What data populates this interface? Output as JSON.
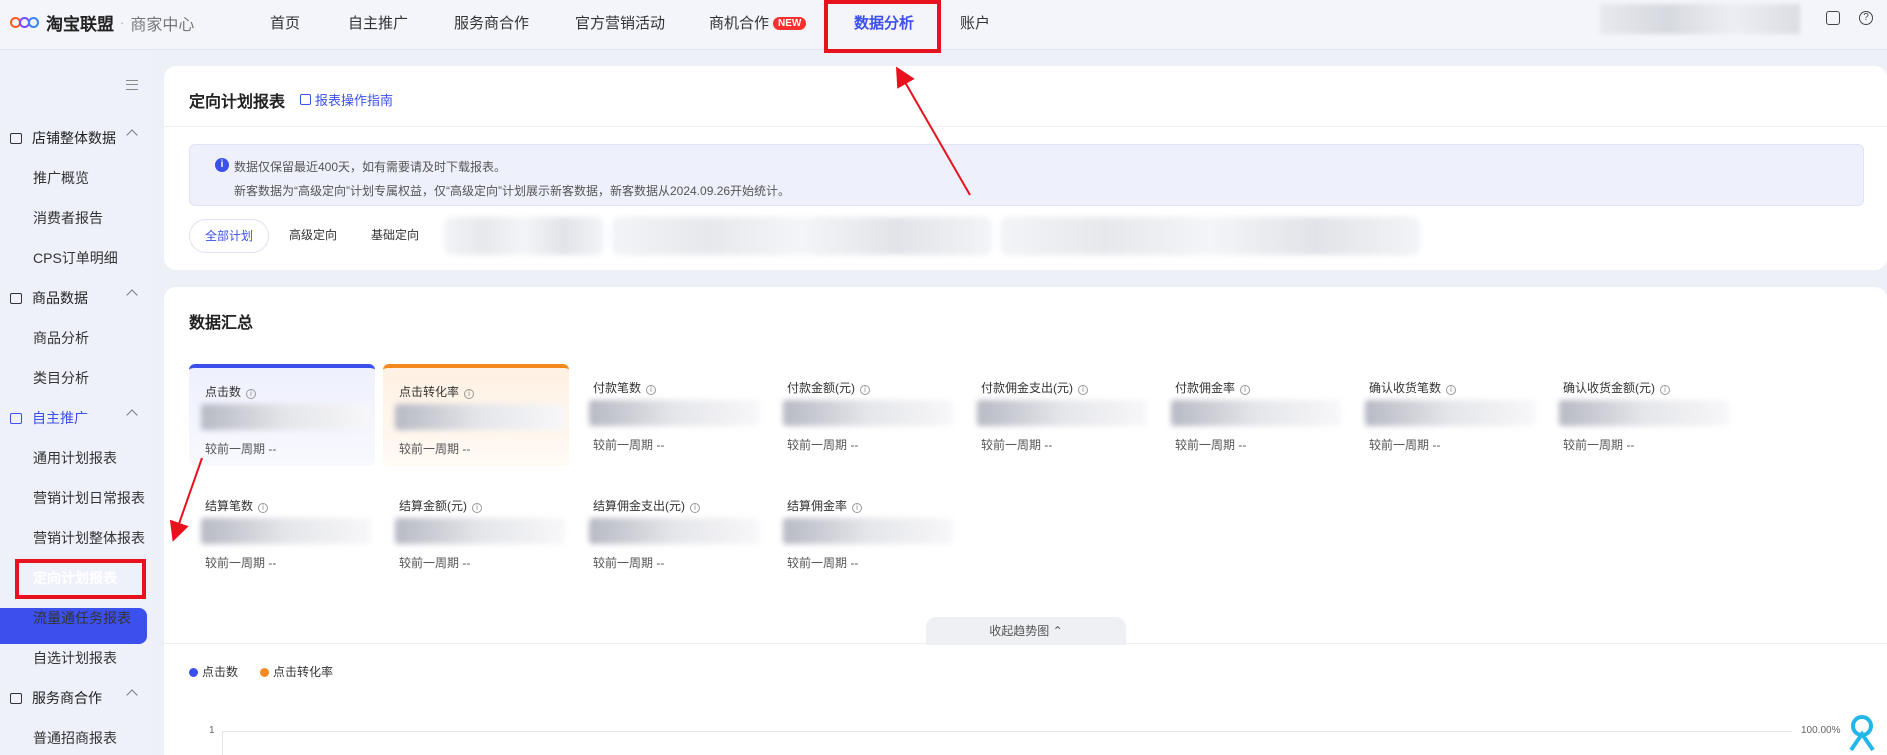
{
  "app": {
    "brand": "淘宝联盟",
    "dot": "·",
    "subtitle": "商家中心"
  },
  "nav": {
    "items": [
      {
        "label": "首页"
      },
      {
        "label": "自主推广"
      },
      {
        "label": "服务商合作"
      },
      {
        "label": "官方营销活动"
      },
      {
        "label": "商机合作",
        "badge": "NEW"
      },
      {
        "label": "数据分析",
        "active": true
      },
      {
        "label": "账户"
      }
    ]
  },
  "sidebar": {
    "groups": [
      {
        "label": "店铺整体数据",
        "items": [
          "推广概览",
          "消费者报告",
          "CPS订单明细"
        ]
      },
      {
        "label": "商品数据",
        "items": [
          "商品分析",
          "类目分析"
        ]
      },
      {
        "label": "自主推广",
        "items": [
          "通用计划报表",
          "营销计划日常报表",
          "营销计划整体报表",
          "定向计划报表",
          "流量通任务报表",
          "自选计划报表"
        ],
        "active_item": "定向计划报表"
      },
      {
        "label": "服务商合作",
        "items": [
          "普通招商报表"
        ]
      }
    ]
  },
  "page": {
    "title": "定向计划报表",
    "guide_link": "报表操作指南",
    "notice": {
      "line1": "数据仅保留最近400天，如有需要请及时下载报表。",
      "line2": "新客数据为“高级定向”计划专属权益，仅“高级定向”计划展示新客数据，新客数据从2024.09.26开始统计。"
    },
    "tabs": [
      "全部计划",
      "高级定向",
      "基础定向"
    ]
  },
  "summary": {
    "title": "数据汇总",
    "compare_label": "较前一周期",
    "compare_value": "--",
    "metrics_row1": [
      "点击数",
      "点击转化率",
      "付款笔数",
      "付款金额(元)",
      "付款佣金支出(元)",
      "付款佣金率",
      "确认收货笔数",
      "确认收货金额(元)"
    ],
    "metrics_row2": [
      "结算笔数",
      "结算金额(元)",
      "结算佣金支出(元)",
      "结算佣金率"
    ],
    "collapse_label": "收起趋势图",
    "legend": [
      {
        "name": "点击数",
        "color": "#3c50ee"
      },
      {
        "name": "点击转化率",
        "color": "#f5891f"
      }
    ],
    "axis_left_top": "1",
    "axis_right_top": "100.00%"
  },
  "colors": {
    "accent": "#3c50ee",
    "highlight": "#e8121e",
    "orange": "#f5891f"
  }
}
